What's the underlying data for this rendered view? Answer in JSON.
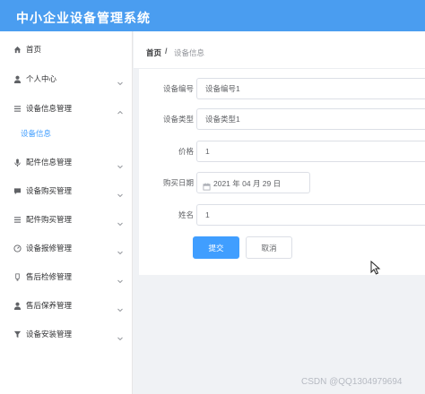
{
  "header": {
    "app_title": "中小企业设备管理系统"
  },
  "sidebar": {
    "items": [
      {
        "label": "首页",
        "icon": "home-icon",
        "has_arrow": false
      },
      {
        "label": "个人中心",
        "icon": "user-icon",
        "has_arrow": true
      },
      {
        "label": "设备信息管理",
        "icon": "list-icon",
        "has_arrow": true,
        "expanded": true
      },
      {
        "label": "配件信息管理",
        "icon": "microphone-icon",
        "has_arrow": true
      },
      {
        "label": "设备购买管理",
        "icon": "chat-icon",
        "has_arrow": true
      },
      {
        "label": "配件购买管理",
        "icon": "list-icon",
        "has_arrow": true
      },
      {
        "label": "设备报修管理",
        "icon": "gauge-icon",
        "has_arrow": true
      },
      {
        "label": "售后检修管理",
        "icon": "bulb-icon",
        "has_arrow": true
      },
      {
        "label": "售后保养管理",
        "icon": "user-icon",
        "has_arrow": true
      },
      {
        "label": "设备安装管理",
        "icon": "funnel-icon",
        "has_arrow": true
      }
    ],
    "submenu_active": "设备信息"
  },
  "breadcrumb": {
    "home": "首页",
    "separator": "/",
    "current": "设备信息"
  },
  "form": {
    "fields": [
      {
        "label": "设备编号",
        "value": "设备编号1"
      },
      {
        "label": "设备类型",
        "value": "设备类型1"
      },
      {
        "label": "价格",
        "value": "1"
      },
      {
        "label": "购买日期",
        "value": "2021 年 04 月 29 日"
      },
      {
        "label": "姓名",
        "value": "1"
      }
    ],
    "submit_label": "提交",
    "cancel_label": "取消"
  },
  "watermark": "CSDN @QQ1304979694",
  "colors": {
    "header_bg": "#4a9df0",
    "accent": "#409eff"
  }
}
